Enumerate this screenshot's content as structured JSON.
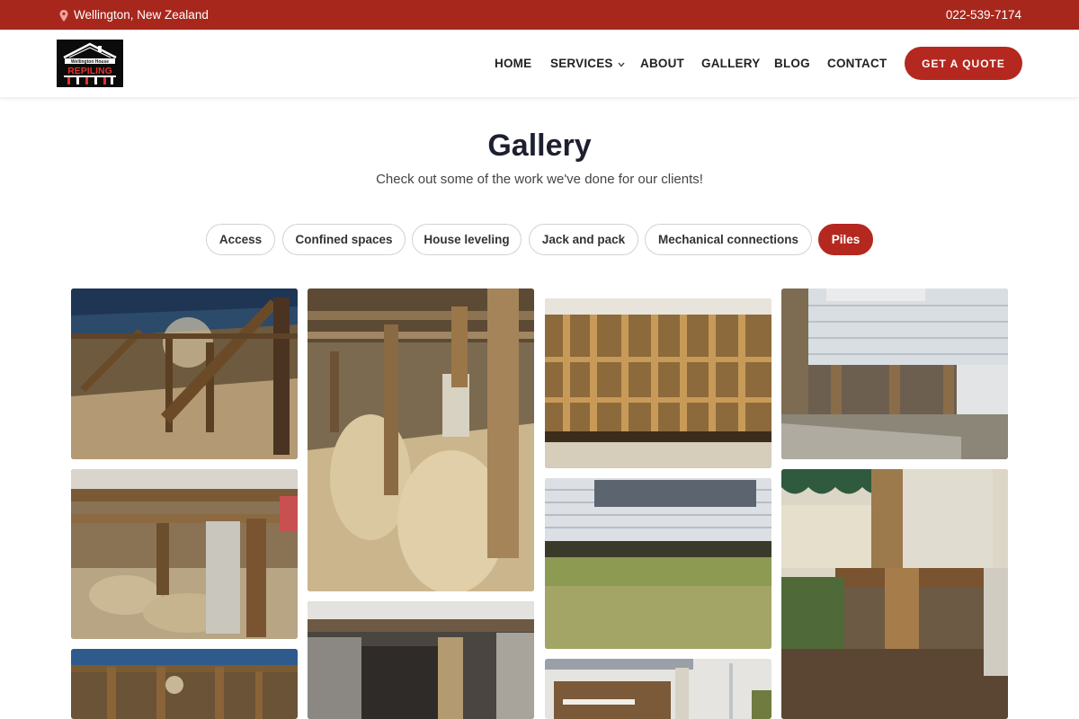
{
  "topbar": {
    "location": "Wellington, New Zealand",
    "phone": "022-539-7174",
    "pin_icon": "map-pin-icon",
    "color": "#a8271d"
  },
  "logo": {
    "line1": "Wellington House",
    "line2": "REPILING"
  },
  "nav": {
    "home": "HOME",
    "services": "SERVICES",
    "about": "ABOUT",
    "gallery": "GALLERY",
    "blog": "BLOG",
    "contact": "CONTACT",
    "active": "GALLERY"
  },
  "cta": {
    "label": "GET A QUOTE",
    "color": "#b5281f"
  },
  "page": {
    "title": "Gallery",
    "subtitle": "Check out some of the work we've done for our clients!"
  },
  "filters": [
    {
      "label": "Access",
      "active": false
    },
    {
      "label": "Confined spaces",
      "active": false
    },
    {
      "label": "House leveling",
      "active": false
    },
    {
      "label": "Jack and pack",
      "active": false
    },
    {
      "label": "Mechanical connections",
      "active": false
    },
    {
      "label": "Piles",
      "active": true
    }
  ],
  "gallery": {
    "photos": [
      "underfloor-tarp-bracing",
      "sand-piles-crawlspace",
      "wall-framing-insulation",
      "weatherboard-house-piles",
      "timber-piles-bearers",
      "weatherboard-house-lawn",
      "corner-pile-garden",
      "underfloor-blue-tarp",
      "concrete-foundation-beam",
      "downpipe-house-corner"
    ]
  }
}
